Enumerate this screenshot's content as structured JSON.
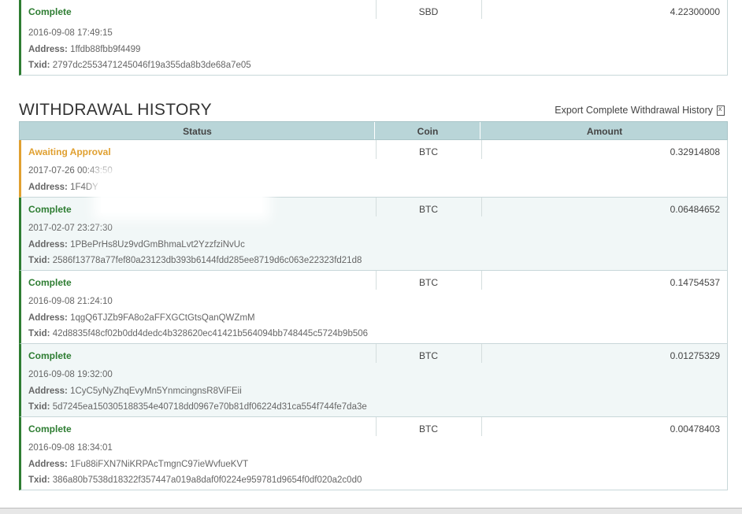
{
  "deposit_partial": {
    "status": "Complete",
    "coin": "SBD",
    "amount": "4.22300000",
    "datetime": "2016-09-08   17:49:15",
    "address_label": "Address:",
    "address": "1ffdb88fbb9f4499",
    "txid_label": "Txid:",
    "txid": "2797dc2553471245046f19a355da8b3de68a7e05"
  },
  "withdrawal": {
    "title": "WITHDRAWAL HISTORY",
    "export_label": "Export Complete Withdrawal History",
    "columns": {
      "status": "Status",
      "coin": "Coin",
      "amount": "Amount"
    },
    "rows": [
      {
        "status": "Awaiting Approval",
        "coin": "BTC",
        "amount": "0.32914808",
        "datetime": "2017-07-26   00:43:50",
        "address_label": "Address:",
        "address": "1F4DY"
      },
      {
        "status": "Complete",
        "coin": "BTC",
        "amount": "0.06484652",
        "datetime": "2017-02-07   23:27:30",
        "address_label": "Address:",
        "address": "1PBePrHs8Uz9vdGmBhmaLvt2YzzfziNvUc",
        "txid_label": "Txid:",
        "txid": "2586f13778a77fef80a23123db393b6144fdd285ee8719d6c063e22323fd21d8"
      },
      {
        "status": "Complete",
        "coin": "BTC",
        "amount": "0.14754537",
        "datetime": "2016-09-08   21:24:10",
        "address_label": "Address:",
        "address": "1qgQ6TJZb9FA8o2aFFXGCtGtsQanQWZmM",
        "txid_label": "Txid:",
        "txid": "42d8835f48cf02b0dd4dedc4b328620ec41421b564094bb748445c5724b9b506"
      },
      {
        "status": "Complete",
        "coin": "BTC",
        "amount": "0.01275329",
        "datetime": "2016-09-08   19:32:00",
        "address_label": "Address:",
        "address": "1CyC5yNyZhqEvyMn5YnmcingnsR8ViFEii",
        "txid_label": "Txid:",
        "txid": "5d7245ea150305188354e40718dd0967e70b81df06224d31ca554f744fe7da3e"
      },
      {
        "status": "Complete",
        "coin": "BTC",
        "amount": "0.00478403",
        "datetime": "2016-09-08   18:34:01",
        "address_label": "Address:",
        "address": "1Fu88iFXN7NiKRPAcTmgnC97ieWvfueKVT",
        "txid_label": "Txid:",
        "txid": "386a80b7538d18322f357447a019a8daf0f0224e959781d9654f0df020a2c0d0"
      }
    ]
  },
  "colors": {
    "complete": "#2e7d32",
    "pending": "#e0a030",
    "header_bg": "#b9d5d8",
    "alt_row_bg": "#f1f7f7"
  },
  "icons": {
    "export": "excel-export-icon"
  }
}
